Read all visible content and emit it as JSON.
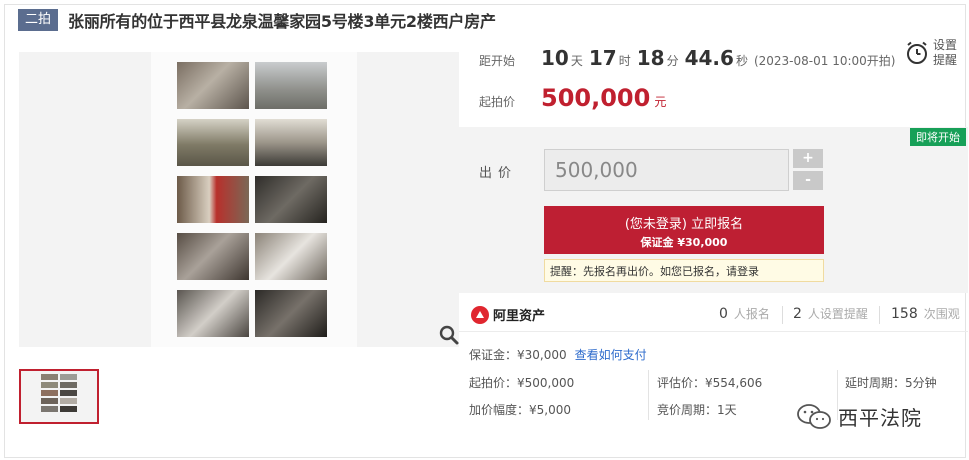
{
  "header": {
    "round_tag": "二拍",
    "title": "张丽所有的位于西平县龙泉温馨家园5号楼3单元2楼西户房产"
  },
  "countdown": {
    "label": "距开始",
    "days": "10",
    "days_unit": "天",
    "hours": "17",
    "hours_unit": "时",
    "minutes": "18",
    "minutes_unit": "分",
    "seconds": "44.6",
    "seconds_unit": "秒",
    "start_note": "(2023-08-01 10:00开拍)"
  },
  "remind": {
    "line1": "设置",
    "line2": "提醒"
  },
  "start_price": {
    "label": "起拍价",
    "value": "500,000",
    "unit": "元"
  },
  "bid": {
    "status": "即将开始",
    "label": "出价",
    "value": "500,000",
    "plus": "+",
    "minus": "-",
    "signup_line1": "(您未登录) 立即报名",
    "signup_line2": "保证金 ¥30,000",
    "hint": "提醒：先报名再出价。如您已报名，请登录"
  },
  "stats": {
    "brand": "阿里资产",
    "signups": "0",
    "signups_label": "人报名",
    "reminders": "2",
    "reminders_label": "人设置提醒",
    "views": "158",
    "views_label": "次围观"
  },
  "details": {
    "deposit": "保证金：¥30,000",
    "pay_link": "查看如何支付",
    "start_price": "起拍价：¥500,000",
    "appraisal": "评估价：¥554,606",
    "delay": "延时周期：5分钟",
    "increment": "加价幅度：¥5,000",
    "cycle": "竞价周期：1天"
  },
  "watermark": {
    "text": "西平法院"
  },
  "icons": [
    "zoom-icon",
    "alarm-clock-icon",
    "ali-assets-logo-icon",
    "wechat-icon"
  ],
  "colors": {
    "accent": "#c0202f",
    "status_green": "#17a058",
    "link": "#2d6bcc",
    "round_tag": "#5b6d8f"
  }
}
